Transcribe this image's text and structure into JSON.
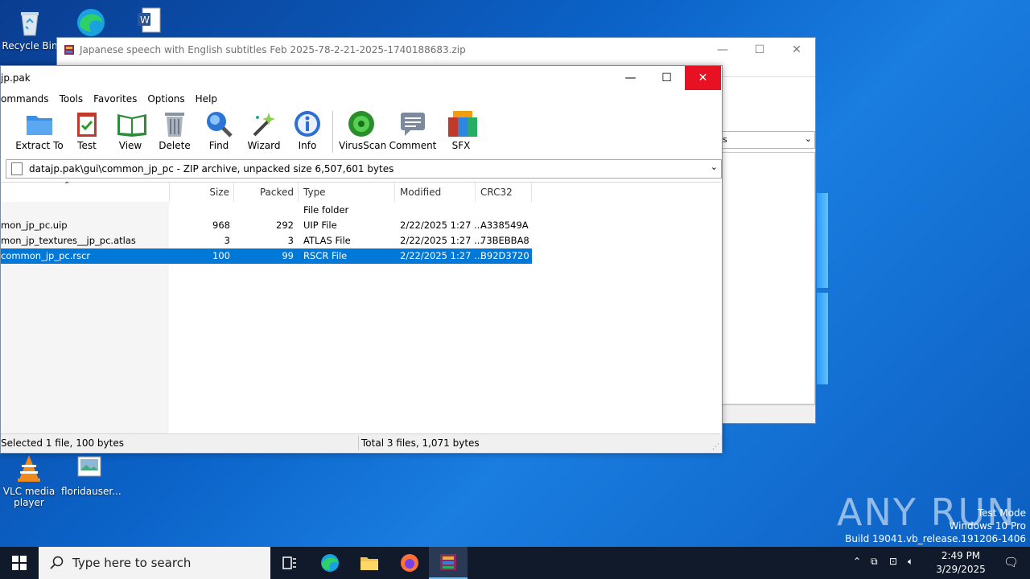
{
  "desktop": {
    "icons": [
      {
        "label": "Recycle Bin"
      },
      {
        "label": "VLC media player"
      },
      {
        "label": "floridauser..."
      }
    ]
  },
  "back_window": {
    "title": "Japanese speech with English subtitles Feb 2025-78-2-21-2025-1740188683.zip",
    "combo_text": "s"
  },
  "window": {
    "title": "jp.pak",
    "menu": [
      "ommands",
      "Tools",
      "Favorites",
      "Options",
      "Help"
    ],
    "toolbar": [
      {
        "label": "Extract To",
        "icon": "extract-to-icon"
      },
      {
        "label": "Test",
        "icon": "test-icon"
      },
      {
        "label": "View",
        "icon": "view-icon"
      },
      {
        "label": "Delete",
        "icon": "delete-icon"
      },
      {
        "label": "Find",
        "icon": "find-icon"
      },
      {
        "label": "Wizard",
        "icon": "wizard-icon"
      },
      {
        "label": "Info",
        "icon": "info-icon"
      },
      {
        "label": "VirusScan",
        "icon": "virusscan-icon"
      },
      {
        "label": "Comment",
        "icon": "comment-icon"
      },
      {
        "label": "SFX",
        "icon": "sfx-icon"
      }
    ],
    "path": "datajp.pak\\gui\\common_jp_pc - ZIP archive, unpacked size 6,507,601 bytes",
    "columns": [
      "Size",
      "Packed",
      "Type",
      "Modified",
      "CRC32"
    ],
    "rows": [
      {
        "name": "",
        "size": "",
        "packed": "",
        "type": "File folder",
        "modified": "",
        "crc": "",
        "selected": false
      },
      {
        "name": "mon_jp_pc.uip",
        "size": "968",
        "packed": "292",
        "type": "UIP File",
        "modified": "2/22/2025 1:27 ...",
        "crc": "A338549A",
        "selected": false
      },
      {
        "name": "mon_jp_textures__jp_pc.atlas",
        "size": "3",
        "packed": "3",
        "type": "ATLAS File",
        "modified": "2/22/2025 1:27 ...",
        "crc": "73BEBBA8",
        "selected": false
      },
      {
        "name": "common_jp_pc.rscr",
        "size": "100",
        "packed": "99",
        "type": "RSCR File",
        "modified": "2/22/2025 1:27 ...",
        "crc": "B92D3720",
        "selected": true
      }
    ],
    "status_left": "Selected 1 file, 100 bytes",
    "status_right": "Total 3 files, 1,071 bytes"
  },
  "taskbar": {
    "search_placeholder": "Type here to search",
    "time": "2:49 PM",
    "date": "3/29/2025"
  },
  "watermark": {
    "line1": "Test Mode",
    "line2": "Windows 10 Pro",
    "line3": "Build 19041.vb_release.191206-1406",
    "logo": "ANY RUN"
  }
}
